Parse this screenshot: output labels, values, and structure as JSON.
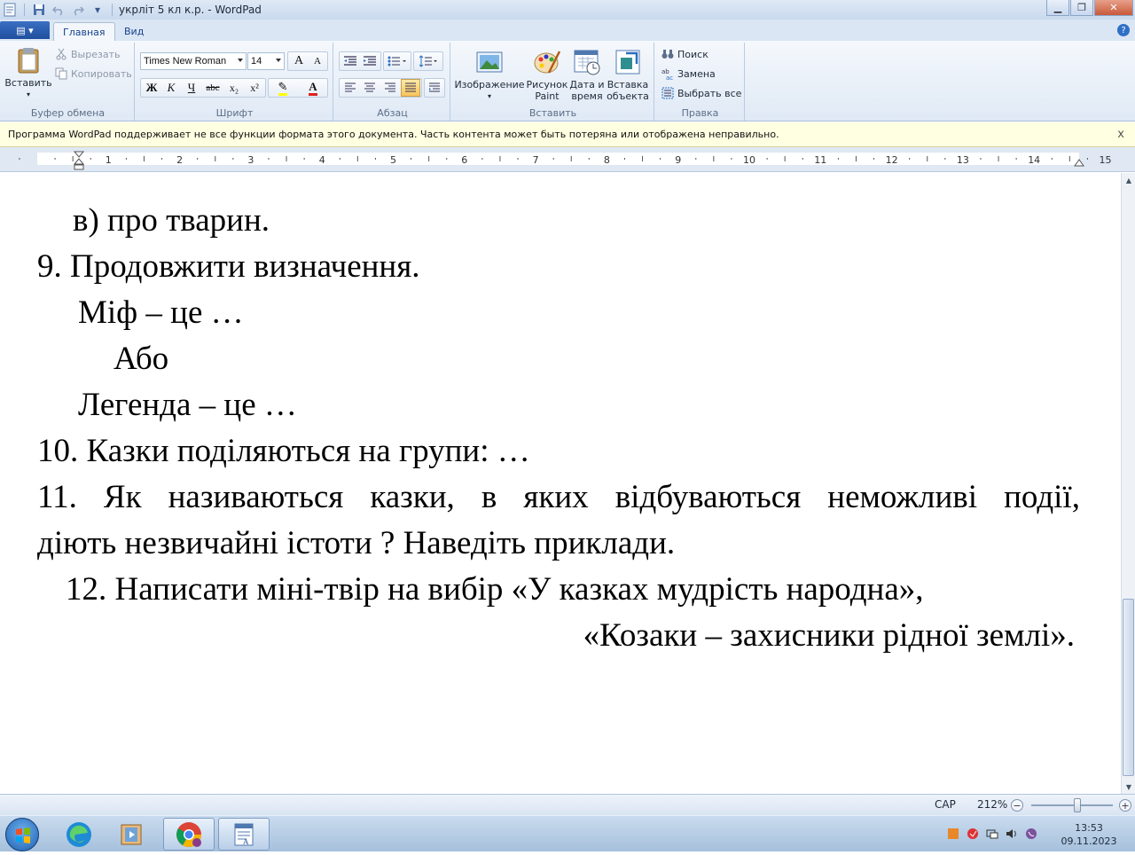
{
  "window": {
    "title": "укрліт 5 кл к.р. - WordPad",
    "minimize": "▁",
    "maximize": "❐",
    "close": "✕"
  },
  "quick_access": {
    "customize": "▾"
  },
  "tabs": [
    {
      "label": "Главная",
      "active": true
    },
    {
      "label": "Вид",
      "active": false
    }
  ],
  "app_button": {
    "label": "▤ ▾"
  },
  "help": "?",
  "ribbon": {
    "clipboard": {
      "label": "Буфер обмена",
      "paste": "Вставить",
      "paste_arrow": "▾",
      "cut": "Вырезать",
      "copy": "Копировать"
    },
    "font": {
      "label": "Шрифт",
      "family": "Times New Roman",
      "size": "14",
      "grow": "A",
      "shrink": "A",
      "bold": "Ж",
      "italic": "К",
      "underline": "Ч",
      "strike": "abc",
      "subscript": "x₂",
      "superscript": "x²",
      "highlight": "✎",
      "color": "A"
    },
    "paragraph": {
      "label": "Абзац"
    },
    "insert": {
      "label": "Вставить",
      "image": "Изображение",
      "image_arrow": "▾",
      "paint": "Рисунок Paint",
      "datetime": "Дата и время",
      "object": "Вставка объекта"
    },
    "editing": {
      "label": "Правка",
      "find": "Поиск",
      "replace": "Замена",
      "select_all": "Выбрать все"
    }
  },
  "infobar": {
    "message": "Программа WordPad поддерживает не все функции формата этого документа. Часть контента может быть потеряна или отображена неправильно.",
    "close": "x"
  },
  "ruler": {
    "numbers": [
      "1",
      "2",
      "3",
      "4",
      "5",
      "6",
      "7",
      "8",
      "9",
      "10",
      "11",
      "12",
      "13",
      "14",
      "15"
    ]
  },
  "document": {
    "lines": [
      "в) про тварин.",
      "9. Продовжити визначення.",
      "Міф – це  …",
      "Або",
      "Легенда – це …",
      "10. Казки поділяються на групи: …",
      "11.   Як називаються казки, в яких відбуваються неможливі події,",
      "діють незвичайні істоти ? Наведіть приклади.",
      "12.  Написати міні-твір на вибір «У казках мудрість народна»,",
      "«Козаки –  захисники рідної землі»."
    ],
    "justified_words": [
      "11.",
      "Як",
      "називаються",
      "казки,",
      "в",
      "яких",
      "відбуваються",
      "неможливі",
      "події,"
    ]
  },
  "scrollbar": {
    "up": "▲",
    "down": "▼"
  },
  "statusbar": {
    "caps": "CAP",
    "zoom": "212%",
    "zoom_out": "−",
    "zoom_in": "+"
  },
  "taskbar": {
    "time": "13:53",
    "date": "09.11.2023"
  }
}
